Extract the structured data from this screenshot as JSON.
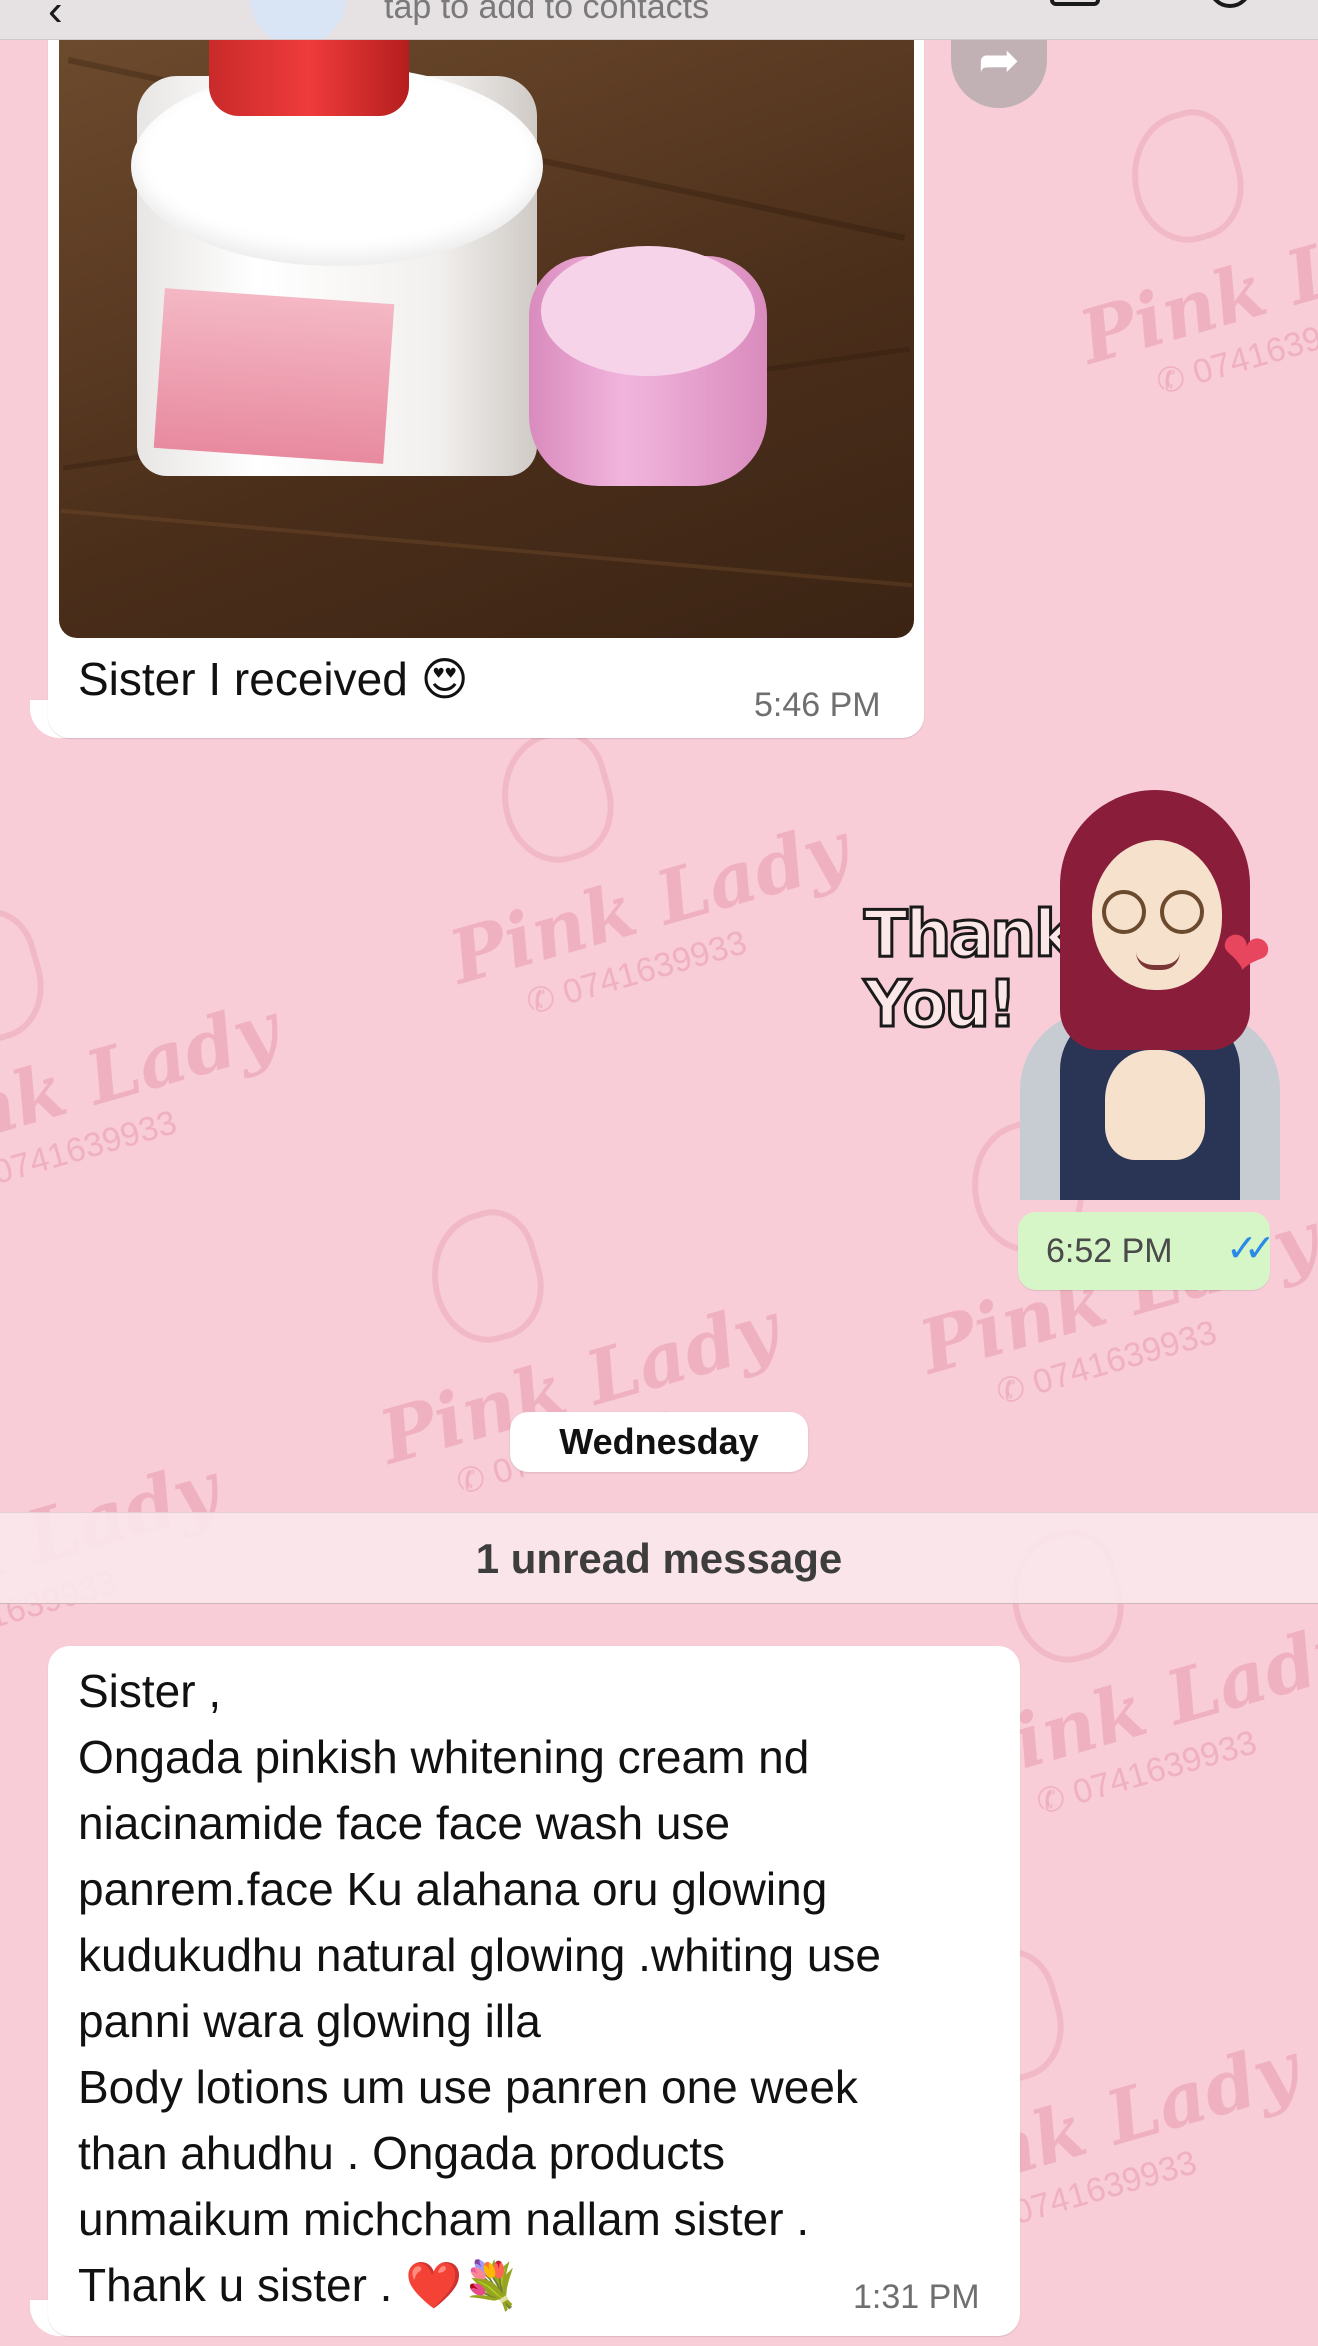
{
  "header": {
    "back_label": "‹",
    "subtitle": "tap to add to contacts"
  },
  "wallpaper": {
    "brand": "Pink Lady",
    "phone": "✆ 0741639933"
  },
  "messages": [
    {
      "direction": "incoming",
      "kind": "image",
      "caption": "Sister I received 😍",
      "time": "5:46 PM"
    },
    {
      "direction": "outgoing",
      "kind": "sticker",
      "sticker_text": "Thank You!",
      "time": "6:52 PM",
      "status_icon": "read-double-check-icon",
      "status_glyph": "✓✓"
    }
  ],
  "date_separator": "Wednesday",
  "unread_banner": "1 unread message",
  "last_message": {
    "direction": "incoming",
    "lines": [
      "Sister ,",
      "Ongada pinkish  whitening  cream nd",
      "niacinamide face face wash use",
      "panrem.face Ku alahana oru glowing",
      "kudukudhu natural glowing .whiting use",
      "panni wara glowing illa",
      "Body lotions um use panren one week",
      "than ahudhu  . Ongada products",
      "unmaikum michcham nallam sister .",
      "Thank u sister . ❤️💐"
    ],
    "time": "1:31 PM"
  },
  "colors": {
    "wallpaper": "#f8cdd8",
    "incoming_bubble": "#ffffff",
    "outgoing_bubble": "#d6f6c8",
    "read_ticks": "#2b8ae8"
  }
}
